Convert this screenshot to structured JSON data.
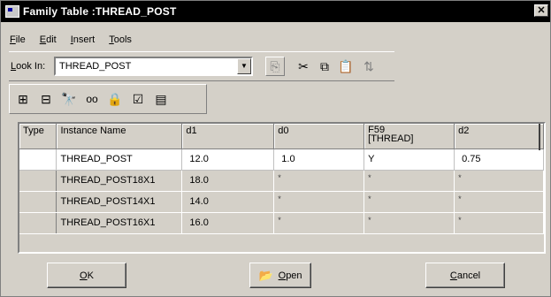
{
  "window": {
    "title": "Family Table :THREAD_POST",
    "close_glyph": "✕"
  },
  "menu": [
    {
      "underline": "F",
      "rest": "ile"
    },
    {
      "underline": "E",
      "rest": "dit"
    },
    {
      "underline": "I",
      "rest": "nsert"
    },
    {
      "underline": "T",
      "rest": "ools"
    }
  ],
  "lookin": {
    "label_ul": "L",
    "label_rest": "ook In:",
    "value": "THREAD_POST",
    "arrow": "▼"
  },
  "toolbar1": {
    "up_folder_icon": "up-folder-icon",
    "cut_icon": "scissors-icon",
    "copy_icon": "copy-icon",
    "paste_icon": "paste-icon",
    "sort_icon": "sort-icon",
    "glyphs": {
      "up": "⎘",
      "cut": "✂",
      "copy": "⧉",
      "paste": "📋",
      "sort": "⇅"
    }
  },
  "toolbar2": {
    "glyphs": {
      "add_column": "⊞",
      "add_row": "⊟",
      "find": "🔭",
      "preview": "oo",
      "lock": "🔒",
      "verify": "☑",
      "table": "▤"
    }
  },
  "grid": {
    "headers": [
      "Type",
      "Instance Name",
      "d1",
      "d0",
      "F59\n[THREAD]",
      "d2"
    ],
    "rows": [
      {
        "type": "",
        "name": "THREAD_POST",
        "d1": "12.0",
        "d0": "1.0",
        "f59": "Y",
        "d2": "0.75"
      },
      {
        "type": "",
        "name": "THREAD_POST18X1",
        "d1": "18.0",
        "d0": "*",
        "f59": "*",
        "d2": "*"
      },
      {
        "type": "",
        "name": "THREAD_POST14X1",
        "d1": "14.0",
        "d0": "*",
        "f59": "*",
        "d2": "*"
      },
      {
        "type": "",
        "name": "THREAD_POST16X1",
        "d1": "16.0",
        "d0": "*",
        "f59": "*",
        "d2": "*"
      }
    ]
  },
  "buttons": {
    "ok_ul": "O",
    "ok_rest": "K",
    "open_ul": "O",
    "open_rest": "pen",
    "cancel_ul": "C",
    "cancel_rest": "ancel"
  }
}
